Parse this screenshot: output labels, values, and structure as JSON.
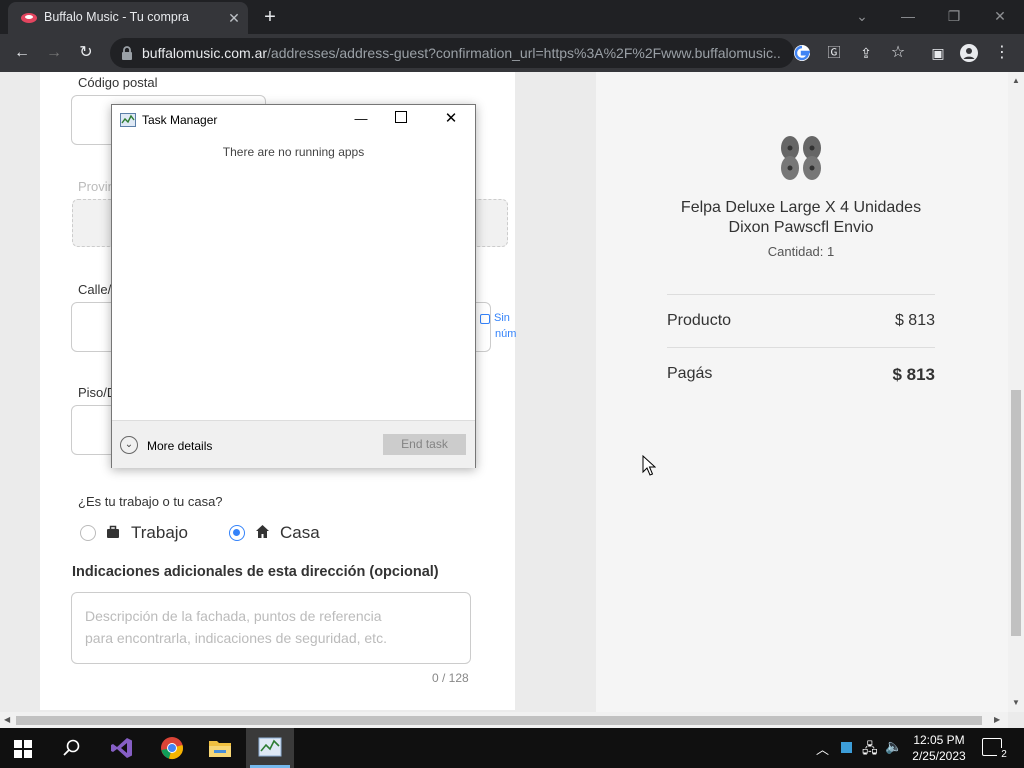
{
  "browser": {
    "tab_title": "Buffalo Music - Tu compra",
    "url_host": "buffalomusic.com.ar",
    "url_path": "/addresses/address-guest?confirmation_url=https%3A%2F%2Fwww.buffalomusic...."
  },
  "form": {
    "postal_code_label": "Código postal",
    "province_label": "Provin",
    "street_label": "Calle/",
    "no_number_label_1": "Sin",
    "no_number_label_2": "núm",
    "floor_label": "Piso/D",
    "work_or_home_question": "¿Es tu trabajo o tu casa?",
    "option_work": "Trabajo",
    "option_home": "Casa",
    "selected_option": "Casa",
    "extra_directions_label": "Indicaciones adicionales de esta dirección (opcional)",
    "extra_directions_placeholder_1": "Descripción de la fachada, puntos de referencia",
    "extra_directions_placeholder_2": "para encontrarla, indicaciones de seguridad, etc.",
    "char_counter": "0 / 128"
  },
  "summary": {
    "product_name_1": "Felpa Deluxe Large X 4 Unidades",
    "product_name_2": "Dixon Pawscfl Envio",
    "quantity": "Cantidad: 1",
    "product_label": "Producto",
    "product_price": "$ 813",
    "total_label": "Pagás",
    "total_price": "$ 813"
  },
  "task_manager": {
    "title": "Task Manager",
    "empty_message": "There are no running apps",
    "more_details": "More details",
    "end_task": "End task"
  },
  "taskbar": {
    "time": "12:05 PM",
    "date": "2/25/2023",
    "notification_count": "2"
  },
  "colors": {
    "accent_radio": "#3483fa",
    "chrome_dark": "#202124"
  }
}
